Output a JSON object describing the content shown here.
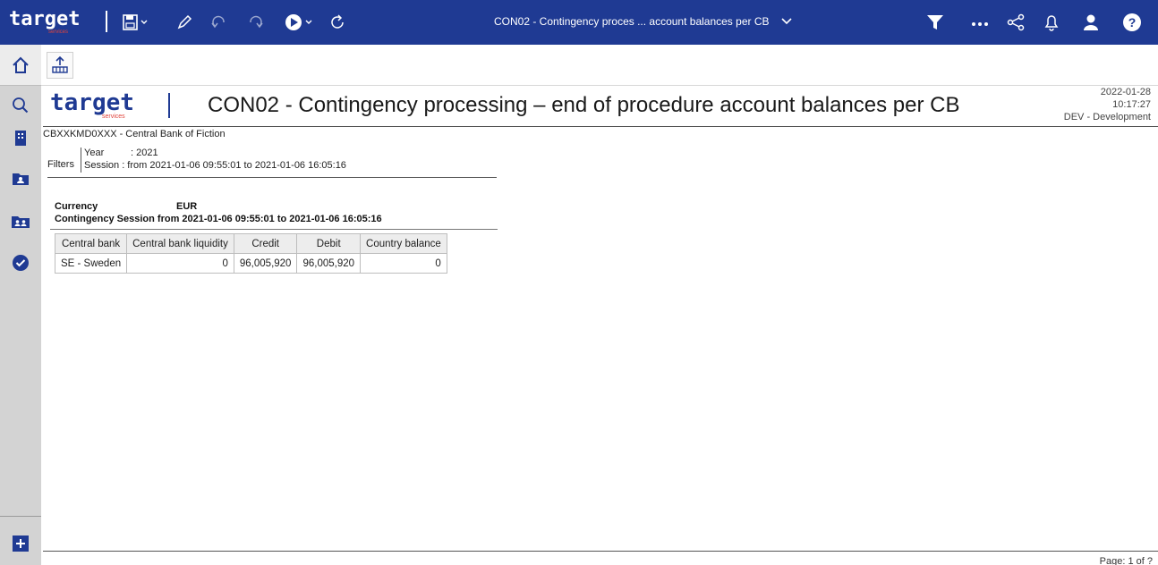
{
  "header": {
    "logo_text": "target",
    "logo_sub": "services",
    "report_title": "CON02 - Contingency proces ... account balances per CB"
  },
  "icons": {
    "save": "save-icon",
    "edit": "pencil-icon",
    "undo": "undo-icon",
    "redo": "redo-icon",
    "run": "play-icon",
    "refresh": "refresh-icon",
    "filter": "filter-icon",
    "more": "more-icon",
    "share": "share-icon",
    "notifications": "bell-icon",
    "user": "user-icon",
    "help": "help-icon"
  },
  "colors": {
    "brand": "#1f3a93",
    "accent": "#e0443c",
    "rail": "#d3d3d3"
  },
  "report": {
    "logo_text": "target",
    "logo_sub": "services",
    "title": "CON02 - Contingency processing – end of procedure account balances per CB",
    "date": "2022-01-28",
    "time": "10:17:27",
    "environment": "DEV - Development",
    "entity": "CBXXKMD0XXX - Central Bank of Fiction"
  },
  "filters": {
    "label": "Filters",
    "year_label": "Year",
    "year_value": ": 2021",
    "session_text": "Session : from 2021-01-06 09:55:01 to 2021-01-06 16:05:16"
  },
  "currency": {
    "label": "Currency",
    "value": "EUR",
    "session_line": "Contingency Session from 2021-01-06 09:55:01 to 2021-01-06 16:05:16"
  },
  "table": {
    "headers": [
      "Central bank",
      "Central bank liquidity",
      "Credit",
      "Debit",
      "Country balance"
    ],
    "rows": [
      [
        "SE - Sweden",
        "0",
        "96,005,920",
        "96,005,920",
        "0"
      ]
    ]
  },
  "footer": {
    "page": "Page: 1 of ?"
  }
}
